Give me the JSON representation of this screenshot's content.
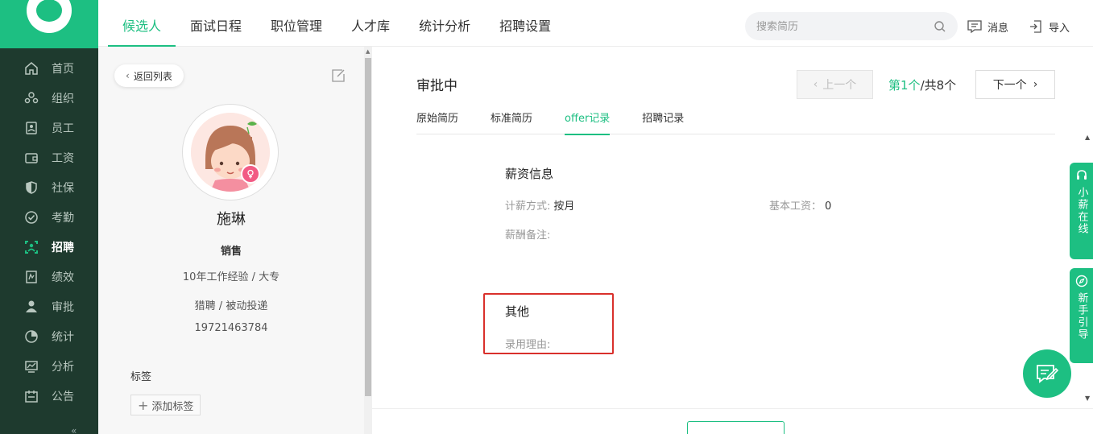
{
  "nav": {
    "items": [
      {
        "label": "首页",
        "icon": "home-icon"
      },
      {
        "label": "组织",
        "icon": "org-icon"
      },
      {
        "label": "员工",
        "icon": "employee-icon"
      },
      {
        "label": "工资",
        "icon": "wallet-icon"
      },
      {
        "label": "社保",
        "icon": "shield-icon"
      },
      {
        "label": "考勤",
        "icon": "check-badge-icon"
      },
      {
        "label": "招聘",
        "icon": "recruit-icon"
      },
      {
        "label": "绩效",
        "icon": "performance-icon"
      },
      {
        "label": "审批",
        "icon": "user-icon"
      },
      {
        "label": "统计",
        "icon": "pie-chart-icon"
      },
      {
        "label": "分析",
        "icon": "analysis-icon"
      },
      {
        "label": "公告",
        "icon": "announcement-icon"
      }
    ],
    "active_index": 6
  },
  "topbar": {
    "tabs": [
      "候选人",
      "面试日程",
      "职位管理",
      "人才库",
      "统计分析",
      "招聘设置"
    ],
    "active_tab": 0,
    "search_placeholder": "搜索简历",
    "messages_label": "消息",
    "import_label": "导入"
  },
  "profile": {
    "back_label": "返回列表",
    "name": "施琳",
    "position": "销售",
    "experience": "10年工作经验 / 大专",
    "source": "猎聘 / 被动投递",
    "phone": "19721463784",
    "tags_title": "标签",
    "add_tag_label": "添加标签"
  },
  "main": {
    "status": "审批中",
    "prev_label": "上一个",
    "next_label": "下一个",
    "pager": {
      "prefix": "第",
      "current": "1个",
      "suffix": "/共8个"
    },
    "sub_tabs": [
      "原始简历",
      "标准简历",
      "offer记录",
      "招聘记录"
    ],
    "active_sub_tab": 2,
    "salary": {
      "title": "薪资信息",
      "method_label": "计薪方式:",
      "method_value": "按月",
      "base_label": "基本工资：",
      "base_value": "0",
      "remark_label": "薪酬备注:"
    },
    "other": {
      "title": "其他",
      "reason_label": "录用理由:"
    }
  },
  "widgets": {
    "online_service": "小薪在线",
    "guide": "新手引导"
  },
  "colors": {
    "accent": "#1dbf82",
    "sidebar_bg": "#1e3a2e",
    "highlight_border": "#d9302b"
  }
}
